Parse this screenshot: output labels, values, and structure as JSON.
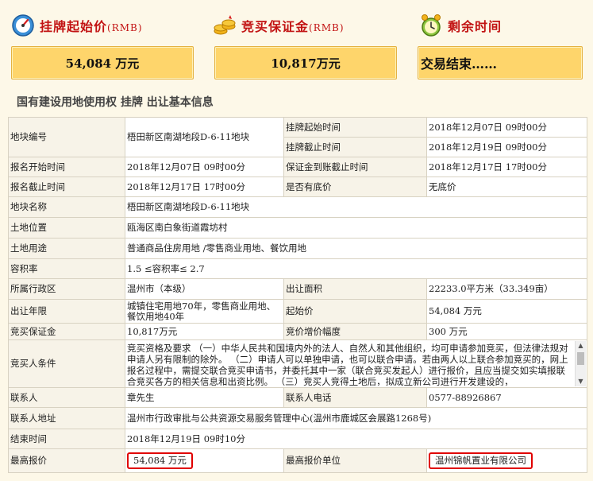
{
  "header": {
    "start_price_label": "挂牌起始价",
    "start_price_unit": "(RMB)",
    "start_price_value": "54,084 万元",
    "deposit_label": "竞买保证金",
    "deposit_unit": "(RMB)",
    "deposit_value": "10,817万元",
    "time_label": "剩余时间",
    "time_value": "交易结束……"
  },
  "subtitle": "国有建设用地使用权 挂牌 出让基本信息",
  "table": {
    "parcel_no_k": "地块编号",
    "parcel_no_v": "梧田新区南湖地段D-6-11地块",
    "list_start_k": "挂牌起始时间",
    "list_start_v": "2018年12月07日 09时00分",
    "list_end_k": "挂牌截止时间",
    "list_end_v": "2018年12月19日 09时00分",
    "reg_start_k": "报名开始时间",
    "reg_start_v": "2018年12月07日 09时00分",
    "deposit_deadline_k": "保证金到账截止时间",
    "deposit_deadline_v": "2018年12月17日 17时00分",
    "reg_end_k": "报名截止时间",
    "reg_end_v": "2018年12月17日 17时00分",
    "reserve_k": "是否有底价",
    "reserve_v": "无底价",
    "name_k": "地块名称",
    "name_v": "梧田新区南湖地段D-6-11地块",
    "location_k": "土地位置",
    "location_v": "瓯海区南白象街道霞坊村",
    "use_k": "土地用途",
    "use_v": "普通商品住房用地 /零售商业用地、餐饮用地",
    "far_k": "容积率",
    "far_v": "1.5 ≤容积率≤ 2.7",
    "district_k": "所属行政区",
    "district_v": "温州市（本级）",
    "area_k": "出让面积",
    "area_v": "22233.0平方米（33.349亩）",
    "term_k": "出让年限",
    "term_v": "城镇住宅用地70年，零售商业用地、餐饮用地40年",
    "start_price_k": "起始价",
    "start_price_v": "54,084 万元",
    "deposit_k": "竞买保证金",
    "deposit_v": "10,817万元",
    "increment_k": "竞价增价幅度",
    "increment_v": "300 万元",
    "conditions_k": "竞买人条件",
    "conditions_v": "竞买资格及要求 （一）中华人民共和国境内外的法人、自然人和其他组织，均可申请参加竞买，但法律法规对申请人另有限制的除外。 （二）申请人可以单独申请，也可以联合申请。若由两人以上联合参加竞买的，网上报名过程中，需提交联合竞买申请书，并委托其中一家（联合竞买发起人）进行报价，且应当提交如实填报联合竞买各方的相关信息和出资比例。 （三）竞买人竞得土地后，拟成立新公司进行开发建设的，",
    "contact_k": "联系人",
    "contact_v": "章先生",
    "phone_k": "联系人电话",
    "phone_v": "0577-88926867",
    "address_k": "联系人地址",
    "address_v": "温州市行政审批与公共资源交易服务管理中心(温州市鹿城区会展路1268号)",
    "end_time_k": "结束时间",
    "end_time_v": "2018年12月19日 09时10分",
    "top_bid_k": "最高报价",
    "top_bid_v": "54,084 万元",
    "top_bidder_k": "最高报价单位",
    "top_bidder_v": "温州锦帆置业有限公司"
  }
}
